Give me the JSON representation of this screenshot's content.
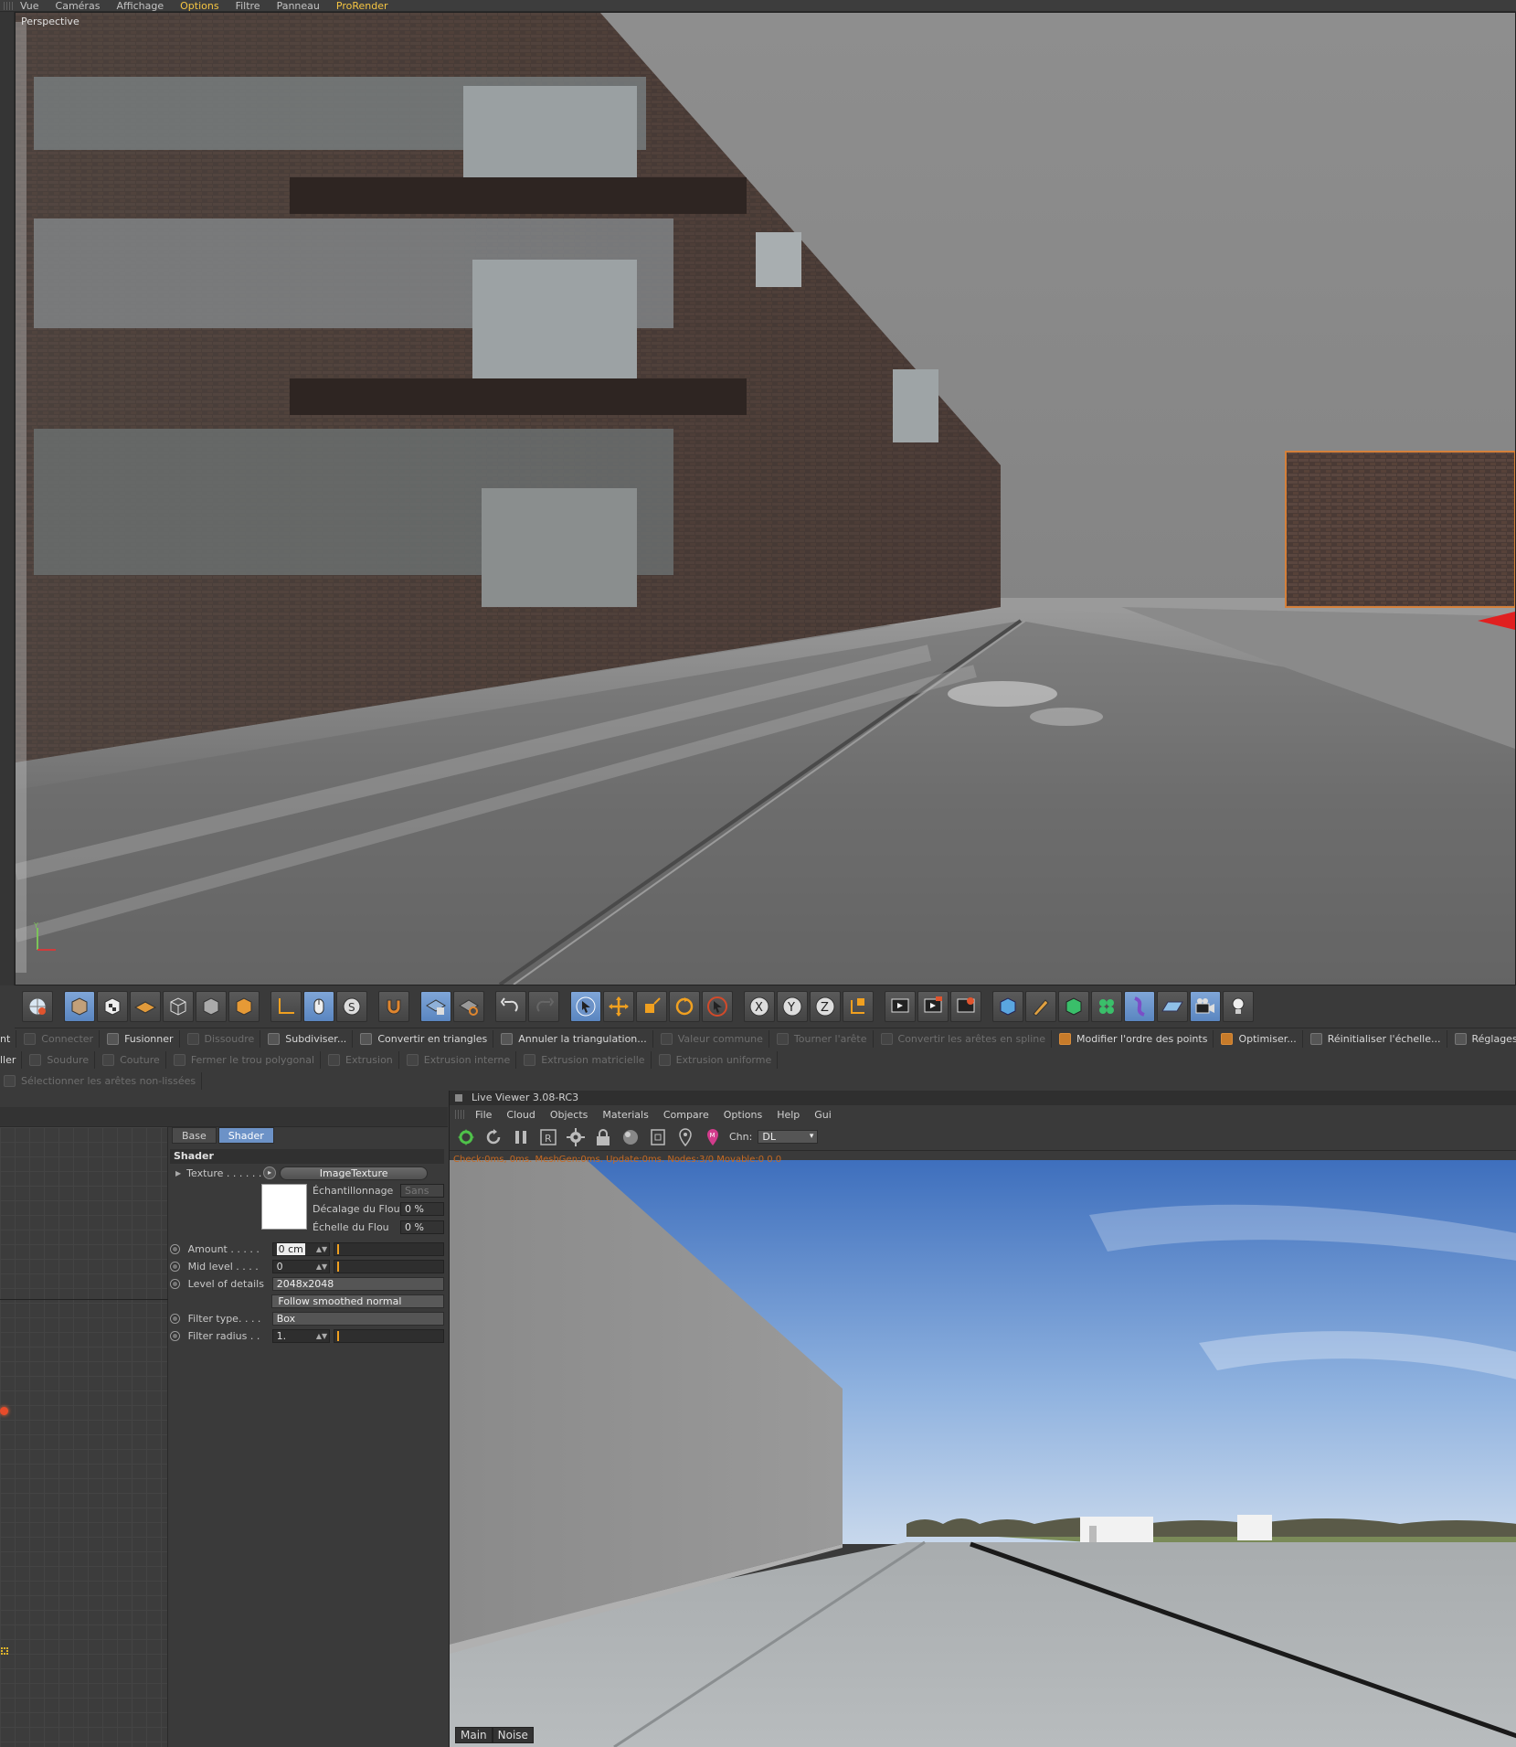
{
  "menubar": {
    "items": [
      "Vue",
      "Caméras",
      "Affichage",
      "Options",
      "Filtre",
      "Panneau",
      "ProRender"
    ],
    "active_index": 3,
    "active_color": "#f5c542"
  },
  "viewport": {
    "label": "Perspective"
  },
  "toolbar": {
    "groups": [
      [
        "globe-icon"
      ],
      [
        "cube-icon",
        "checker-cube-icon",
        "grid-plane-icon",
        "wire-cube-icon",
        "shaded-cube-icon",
        "orange-cube-icon"
      ],
      [
        "axis-icon",
        "mouse-icon",
        "snap-s-icon"
      ],
      [
        "magnet-icon"
      ],
      [
        "mesh-lock-icon",
        "mesh-rotate-icon"
      ],
      [
        "undo-icon",
        "redo-icon"
      ],
      [
        "select-icon",
        "move-icon",
        "scale-icon",
        "rotate-icon",
        "live-select-icon"
      ],
      [
        "x-axis-icon",
        "y-axis-icon",
        "z-axis-icon",
        "coordinate-icon"
      ],
      [
        "render-view-icon",
        "render-picture-icon",
        "render-settings-icon"
      ],
      [
        "primitive-cube-icon",
        "pen-icon",
        "subdivision-icon",
        "array-icon",
        "deformer-icon",
        "floor-icon",
        "camera-icon",
        "light-icon"
      ]
    ]
  },
  "commands": {
    "row1": [
      {
        "label": "Connecter",
        "enabled": false
      },
      {
        "label": "Fusionner",
        "enabled": true
      },
      {
        "label": "Dissoudre",
        "enabled": false
      },
      {
        "label": "Subdiviser...",
        "enabled": true
      },
      {
        "label": "Convertir en triangles",
        "enabled": true
      },
      {
        "label": "Annuler la triangulation...",
        "enabled": true
      },
      {
        "label": "Valeur commune",
        "enabled": false
      },
      {
        "label": "Tourner l'arête",
        "enabled": false
      },
      {
        "label": "Convertir les arêtes en spline",
        "enabled": false
      },
      {
        "label": "Modifier l'ordre des points",
        "enabled": true
      },
      {
        "label": "Optimiser...",
        "enabled": true
      },
      {
        "label": "Réinitialiser l'échelle...",
        "enabled": true
      },
      {
        "label": "Réglages de modélisation",
        "enabled": true
      }
    ],
    "row1_prefix": "nt",
    "row2": [
      {
        "label": "Soudure",
        "enabled": false
      },
      {
        "label": "Couture",
        "enabled": false
      },
      {
        "label": "Fermer le trou polygonal",
        "enabled": false
      },
      {
        "label": "Extrusion",
        "enabled": false
      },
      {
        "label": "Extrusion interne",
        "enabled": false
      },
      {
        "label": "Extrusion matricielle",
        "enabled": false
      },
      {
        "label": "Extrusion uniforme",
        "enabled": false
      }
    ],
    "row2_prefix": "ller",
    "row3": [
      {
        "label": "Sélectionner les arêtes non-lissées",
        "enabled": false
      }
    ]
  },
  "attributes": {
    "tabs": [
      "Base",
      "Shader"
    ],
    "active_tab": 1,
    "section_title": "Shader",
    "texture_label": "Texture . . . . . .",
    "texture_button": "ImageTexture",
    "sampling_label": "Échantillonnage",
    "sampling_value": "Sans",
    "blur_offset_label": "Décalage du Flou",
    "blur_offset_value": "0 %",
    "blur_scale_label": "Échelle du Flou",
    "blur_scale_value": "0 %",
    "amount_label": "Amount . . . . .",
    "amount_value": "0 cm",
    "mid_level_label": "Mid level . . . .",
    "mid_level_value": "0",
    "level_details_label": "Level of details",
    "level_details_value": "2048x2048",
    "follow_button": "Follow smoothed normal",
    "filter_type_label": "Filter type. . . .",
    "filter_type_value": "Box",
    "filter_radius_label": "Filter radius . .",
    "filter_radius_value": "1."
  },
  "live_viewer": {
    "title": "Live Viewer 3.08-RC3",
    "menu": [
      "File",
      "Cloud",
      "Objects",
      "Materials",
      "Compare",
      "Options",
      "Help",
      "Gui"
    ],
    "channel_label": "Chn:",
    "channel_value": "DL",
    "status": "Check:0ms, 0ms. MeshGen:0ms. Update:0ms. Nodes:3/0 Movable:0 0.0",
    "bottom_tabs": [
      "Main",
      "Noise"
    ]
  },
  "colors": {
    "accent_blue": "#6c92c7",
    "orange": "#f0a020",
    "sky": "#4f7fc7"
  }
}
